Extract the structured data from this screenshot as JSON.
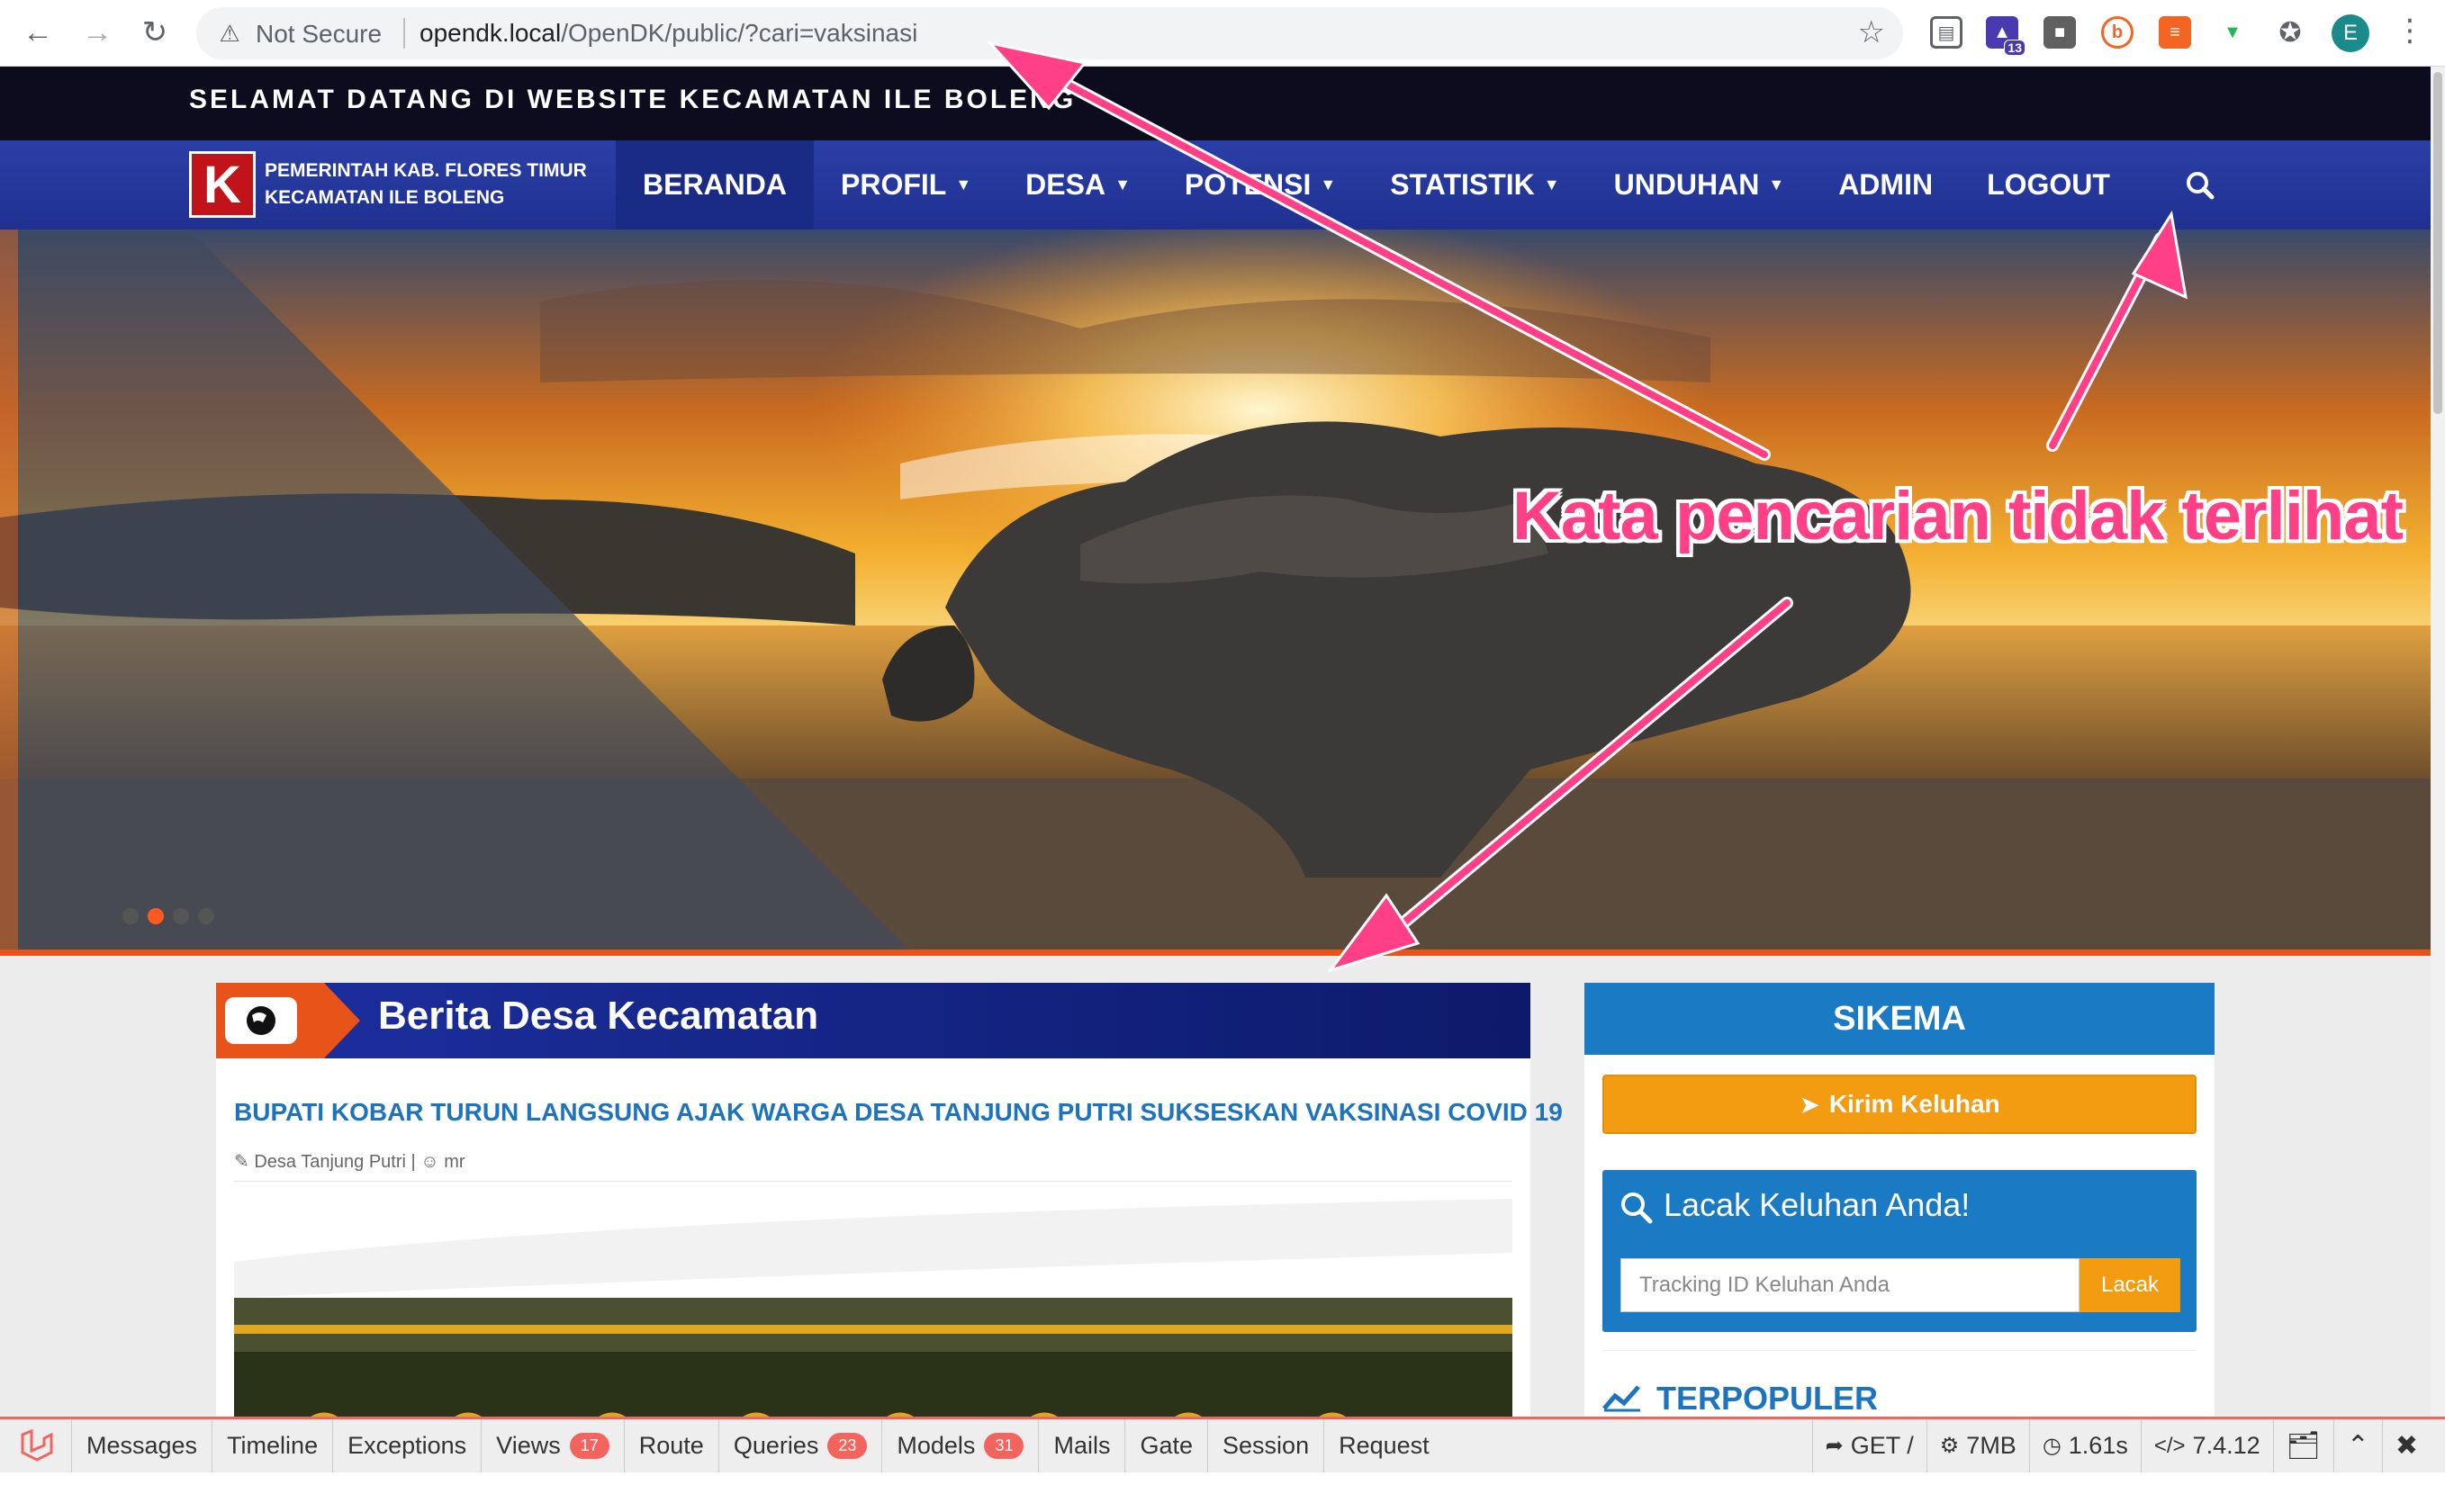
{
  "browser": {
    "security_label": "Not Secure",
    "url_host": "opendk.local",
    "url_path": "/OpenDK/public/?cari=vaksinasi",
    "extension_badge": "13",
    "profile_initial": "E",
    "icons": [
      "back-icon",
      "forward-icon",
      "reload-icon",
      "warning-icon",
      "star-icon",
      "extensions-icon",
      "kebab-menu-icon"
    ]
  },
  "site": {
    "welcome": "SELAMAT DATANG DI WEBSITE KECAMATAN ILE BOLENG",
    "brand_letter": "K",
    "brand_line1": "PEMERINTAH KAB. FLORES TIMUR",
    "brand_line2": "KECAMATAN ILE BOLENG",
    "nav": [
      {
        "label": "BERANDA",
        "dropdown": false
      },
      {
        "label": "PROFIL",
        "dropdown": true
      },
      {
        "label": "DESA",
        "dropdown": true
      },
      {
        "label": "POTENSI",
        "dropdown": true
      },
      {
        "label": "STATISTIK",
        "dropdown": true
      },
      {
        "label": "UNDUHAN",
        "dropdown": true
      },
      {
        "label": "ADMIN",
        "dropdown": false
      },
      {
        "label": "LOGOUT",
        "dropdown": false
      }
    ],
    "colors": {
      "nav": "#2a3fa6",
      "accent": "#e8531a",
      "orange": "#f39c12",
      "blue": "#1a7ac4"
    }
  },
  "news": {
    "heading": "Berita Desa Kecamatan",
    "article_title": "BUPATI KOBAR TURUN LANGSUNG AJAK WARGA DESA TANJUNG PUTRI SUKSESKAN VAKSINASI COVID 19",
    "article_village": "Desa Tanjung Putri",
    "article_author": "mr"
  },
  "sidebar": {
    "sikema_title": "SIKEMA",
    "kirim_label": "Kirim Keluhan",
    "lacak_title": "Lacak Keluhan Anda!",
    "lacak_placeholder": "Tracking ID Keluhan Anda",
    "lacak_button": "Lacak",
    "terpopuler_title": "TERPOPULER"
  },
  "debugbar": {
    "tabs": [
      {
        "label": "Messages",
        "badge": ""
      },
      {
        "label": "Timeline",
        "badge": ""
      },
      {
        "label": "Exceptions",
        "badge": ""
      },
      {
        "label": "Views",
        "badge": "17"
      },
      {
        "label": "Route",
        "badge": ""
      },
      {
        "label": "Queries",
        "badge": "23"
      },
      {
        "label": "Models",
        "badge": "31"
      },
      {
        "label": "Mails",
        "badge": ""
      },
      {
        "label": "Gate",
        "badge": ""
      },
      {
        "label": "Session",
        "badge": ""
      },
      {
        "label": "Request",
        "badge": ""
      }
    ],
    "method": "GET /",
    "memory": "7MB",
    "time": "1.61s",
    "php_version": "7.4.12"
  },
  "annotation": {
    "text": "Kata pencarian tidak terlihat",
    "color": "#ff3f86"
  },
  "hero": {
    "slides": 4,
    "active_slide": 2
  }
}
